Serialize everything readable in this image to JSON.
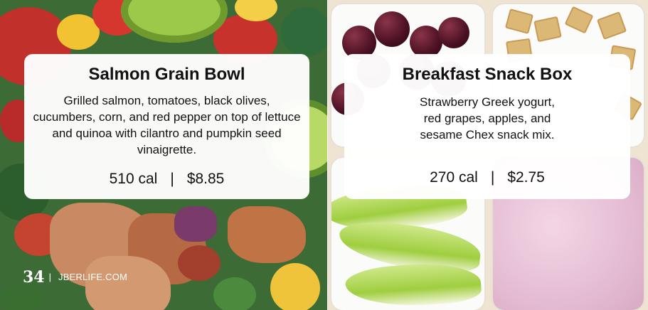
{
  "left_card": {
    "title": "Salmon Grain Bowl",
    "description": "Grilled salmon, tomatoes, black olives, cucumbers, corn, and red pepper on top of lettuce and quinoa with cilantro and pumpkin seed vinaigrette.",
    "calories": "510 cal",
    "separator": "|",
    "price": "$8.85"
  },
  "right_card": {
    "title": "Breakfast Snack Box",
    "description_lines": [
      "Strawberry Greek yogurt,",
      "red grapes, apples, and",
      "sesame Chex snack mix."
    ],
    "calories": "270 cal",
    "separator": "|",
    "price": "$2.75"
  },
  "footer": {
    "page_number": "34",
    "separator": "|",
    "site": "JBERLIFE.COM"
  }
}
